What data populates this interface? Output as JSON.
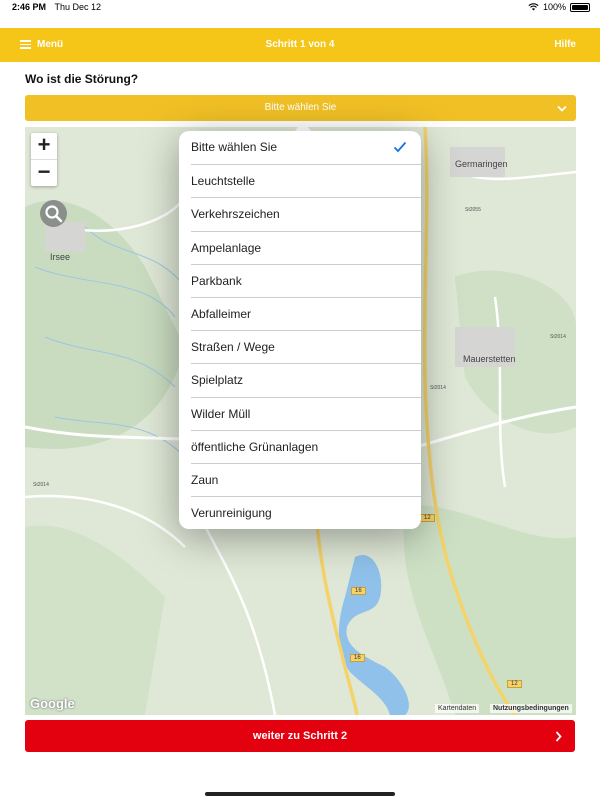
{
  "status_bar": {
    "time": "2:46 PM",
    "date": "Thu Dec 12",
    "battery": "100%"
  },
  "top_bar": {
    "menu_label": "Menü",
    "title": "Schritt 1 von 4",
    "help_label": "Hilfe"
  },
  "question": "Wo ist die Störung?",
  "select": {
    "value": "Bitte wählen Sie"
  },
  "dropdown": {
    "selected_index": 0,
    "options": [
      "Bitte wählen Sie",
      "Leuchtstelle",
      "Verkehrszeichen",
      "Ampelanlage",
      "Parkbank",
      "Abfalleimer",
      "Straßen / Wege",
      "Spielplatz",
      "Wilder Müll",
      "öffentliche Grünanlagen",
      "Zaun",
      "Verunreinigung"
    ]
  },
  "map": {
    "places": {
      "irsee": "Irsee",
      "germaringen": "Germaringen",
      "mauerstetten": "Mauerstetten"
    },
    "road_labels": {
      "st2014_a": "St2014",
      "st2014_b": "St2014",
      "st2014_c": "St2014",
      "st2055": "St2055"
    },
    "route_shields": {
      "r16a": "16",
      "r16b": "16",
      "r12a": "12",
      "r12b": "12"
    },
    "attribution": {
      "data": "Kartendaten",
      "terms": "Nutzungsbedingungen"
    },
    "logo": "Google"
  },
  "next_button": {
    "label": "weiter zu Schritt 2"
  },
  "colors": {
    "header": "#f5c518",
    "select": "#f0c025",
    "primary_button": "#e3000f",
    "check": "#1a73e8"
  }
}
